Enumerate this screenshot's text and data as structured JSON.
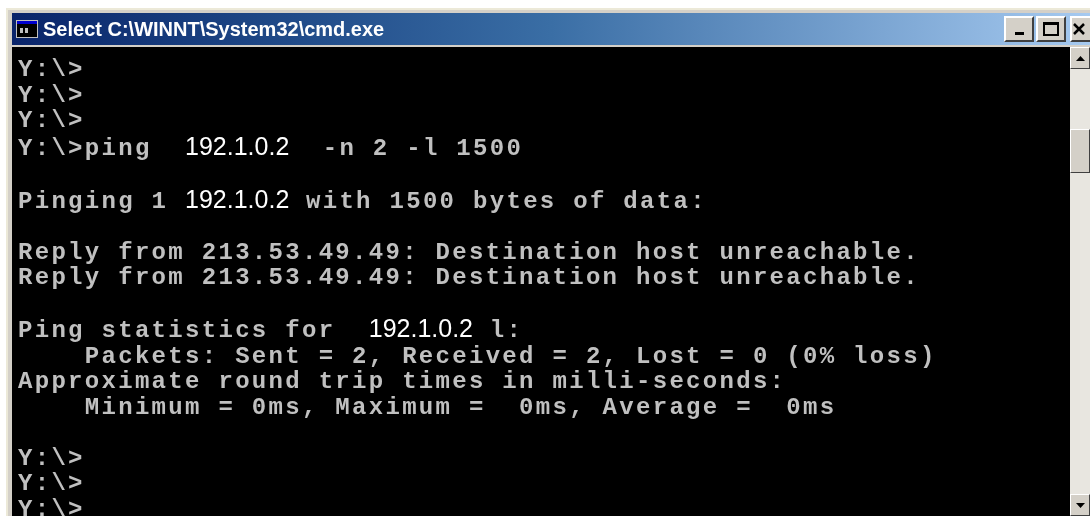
{
  "window": {
    "title": "Select C:\\WINNT\\System32\\cmd.exe"
  },
  "console": {
    "lines": [
      {
        "segments": [
          {
            "kind": "console",
            "text": "Y:\\>"
          }
        ]
      },
      {
        "segments": [
          {
            "kind": "console",
            "text": "Y:\\>"
          }
        ]
      },
      {
        "segments": [
          {
            "kind": "console",
            "text": "Y:\\>"
          }
        ]
      },
      {
        "segments": [
          {
            "kind": "console",
            "text": "Y:\\>ping  "
          },
          {
            "kind": "overlay",
            "text": "192.1.0.2"
          },
          {
            "kind": "console",
            "text": "  -n 2 -l 1500"
          }
        ]
      },
      {
        "kind": "blank"
      },
      {
        "segments": [
          {
            "kind": "console",
            "text": "Pinging 1 "
          },
          {
            "kind": "overlay",
            "text": "192.1.0.2"
          },
          {
            "kind": "console",
            "text": " with 1500 bytes of data:"
          }
        ]
      },
      {
        "kind": "blank"
      },
      {
        "segments": [
          {
            "kind": "console",
            "text": "Reply from 213.53.49.49: Destination host unreachable."
          }
        ]
      },
      {
        "segments": [
          {
            "kind": "console",
            "text": "Reply from 213.53.49.49: Destination host unreachable."
          }
        ]
      },
      {
        "kind": "blank"
      },
      {
        "segments": [
          {
            "kind": "console",
            "text": "Ping statistics for  "
          },
          {
            "kind": "overlay",
            "text": "192.1.0.2"
          },
          {
            "kind": "console",
            "text": " l:"
          }
        ]
      },
      {
        "segments": [
          {
            "kind": "console",
            "text": "    Packets: Sent = 2, Received = 2, Lost = 0 (0% loss)"
          }
        ]
      },
      {
        "segments": [
          {
            "kind": "console",
            "text": "Approximate round trip times in milli-seconds:"
          }
        ]
      },
      {
        "segments": [
          {
            "kind": "console",
            "text": "    Minimum = 0ms, Maximum =  0ms, Average =  0ms"
          }
        ]
      },
      {
        "kind": "blank"
      },
      {
        "segments": [
          {
            "kind": "console",
            "text": "Y:\\>"
          }
        ]
      },
      {
        "segments": [
          {
            "kind": "console",
            "text": "Y:\\>"
          }
        ]
      },
      {
        "segments": [
          {
            "kind": "console",
            "text": "Y:\\>"
          }
        ]
      }
    ]
  }
}
